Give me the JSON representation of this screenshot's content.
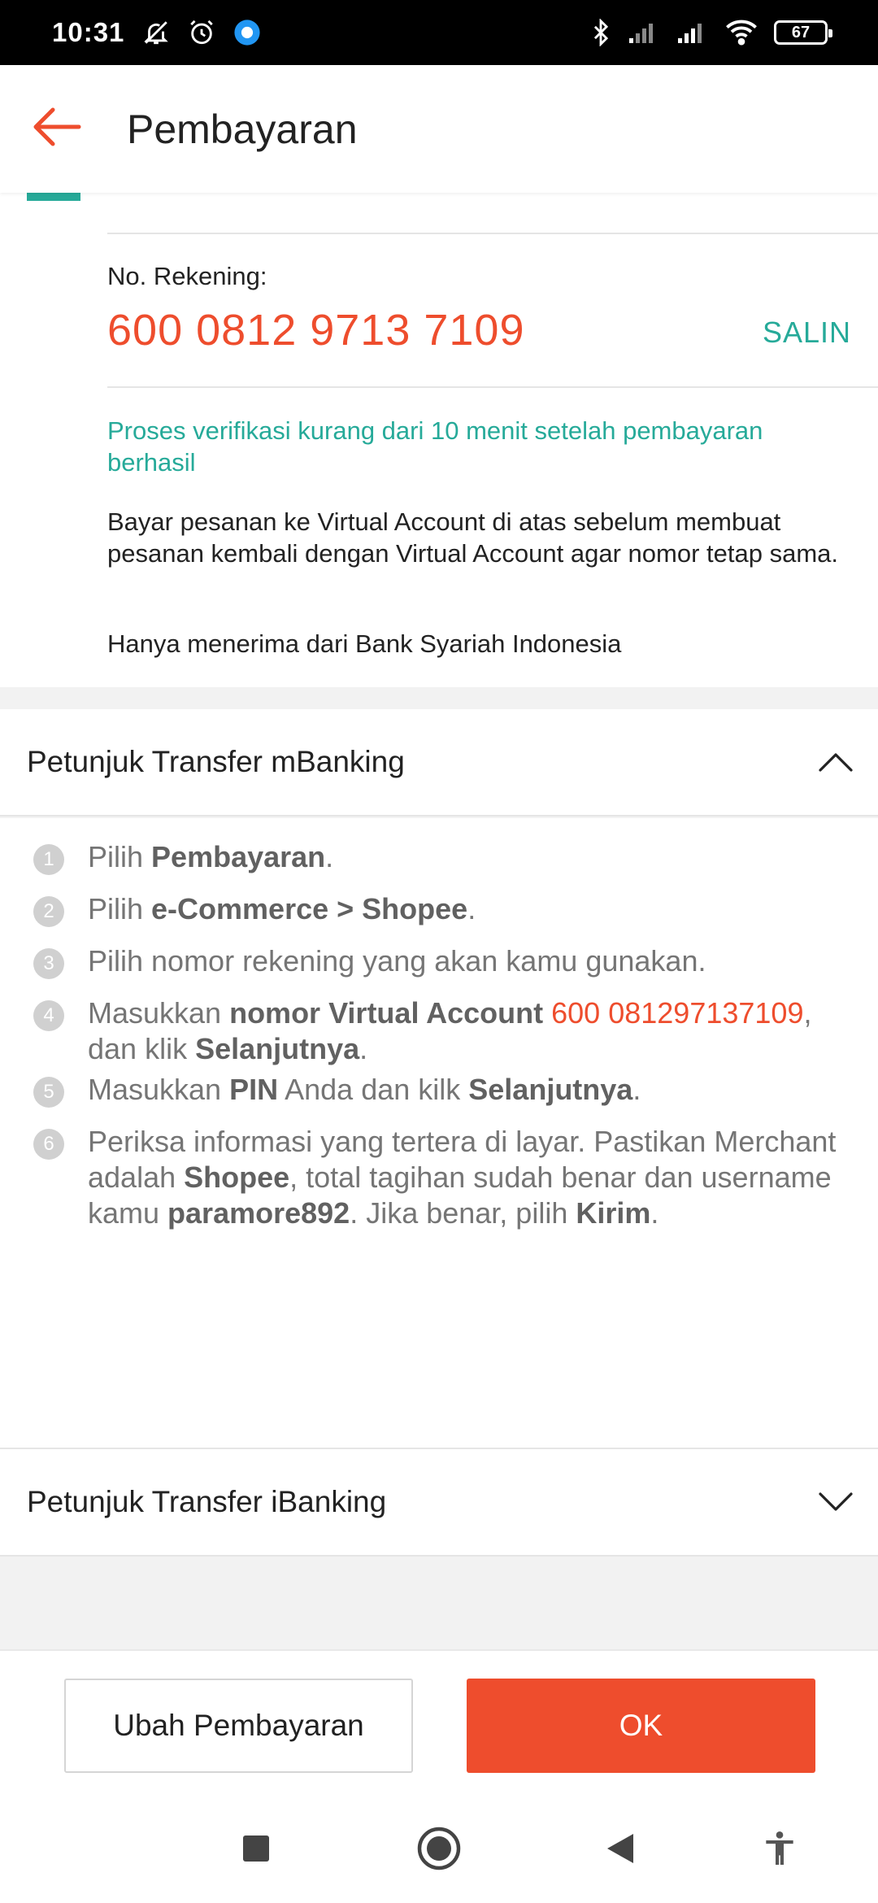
{
  "status_bar": {
    "time": "10:31",
    "battery": "67"
  },
  "appbar": {
    "title": "Pembayaran"
  },
  "account": {
    "label": "No. Rekening:",
    "number": "600 0812 9713 7109",
    "copy_label": "SALIN",
    "verify_note": "Proses verifikasi kurang dari 10 menit setelah pembayaran berhasil",
    "info_1": "Bayar pesanan ke Virtual Account di atas sebelum membuat pesanan kembali dengan Virtual Account agar nomor tetap sama.",
    "info_2": "Hanya menerima dari Bank Syariah Indonesia"
  },
  "mbanking": {
    "title": "Petunjuk Transfer mBanking",
    "steps": [
      {
        "num": "1",
        "parts": [
          {
            "t": "Pilih "
          },
          {
            "t": "Pembayaran",
            "b": true
          },
          {
            "t": "."
          }
        ]
      },
      {
        "num": "2",
        "parts": [
          {
            "t": "Pilih "
          },
          {
            "t": "e-Commerce > Shopee",
            "b": true
          },
          {
            "t": "."
          }
        ]
      },
      {
        "num": "3",
        "parts": [
          {
            "t": "Pilih nomor rekening yang akan kamu gunakan."
          }
        ]
      },
      {
        "num": "4",
        "parts": [
          {
            "t": "Masukkan "
          },
          {
            "t": "nomor Virtual Account",
            "b": true
          },
          {
            "t": " "
          },
          {
            "t": "600 081297137109",
            "o": true
          },
          {
            "t": ", dan klik "
          },
          {
            "t": "Selanjutnya",
            "b": true
          },
          {
            "t": "."
          }
        ]
      },
      {
        "num": "5",
        "parts": [
          {
            "t": "Masukkan "
          },
          {
            "t": "PIN",
            "b": true
          },
          {
            "t": " Anda dan kilk "
          },
          {
            "t": "Selanjutnya",
            "b": true
          },
          {
            "t": "."
          }
        ]
      },
      {
        "num": "6",
        "parts": [
          {
            "t": "Periksa informasi yang tertera di layar. Pastikan Merchant adalah "
          },
          {
            "t": "Shopee",
            "b": true
          },
          {
            "t": ", total tagihan sudah benar dan username kamu "
          },
          {
            "t": "paramore892",
            "b": true
          },
          {
            "t": ". Jika benar, pilih "
          },
          {
            "t": "Kirim",
            "b": true
          },
          {
            "t": "."
          }
        ]
      }
    ]
  },
  "ibanking": {
    "title": "Petunjuk Transfer iBanking"
  },
  "actions": {
    "change_label": "Ubah Pembayaran",
    "ok_label": "OK"
  },
  "colors": {
    "accent": "#ee4d2d",
    "teal": "#26aa99"
  },
  "icons": {
    "back": "arrow-left-icon",
    "collapse": "chevron-up-icon",
    "expand": "chevron-down-icon",
    "nav_recents": "square-icon",
    "nav_home": "circle-icon",
    "nav_back": "triangle-back-icon",
    "nav_accessibility": "accessibility-icon"
  }
}
